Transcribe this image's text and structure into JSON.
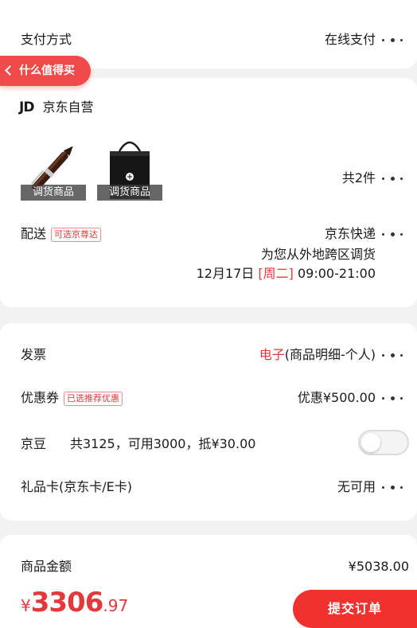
{
  "payment": {
    "label": "支付方式",
    "value": "在线支付"
  },
  "back_pill": {
    "label": "什么值得买"
  },
  "store": {
    "logo": "JD",
    "name": "京东自营",
    "products": [
      {
        "caption": "调货商品",
        "image": "pen-image"
      },
      {
        "caption": "调货商品",
        "image": "gift-bag-image"
      }
    ],
    "count": "共2件",
    "delivery_label": "配送",
    "delivery_tag": "可选京尊达",
    "delivery_method": "京东快递",
    "delivery_note": "为您从外地跨区调货",
    "delivery_date": "12月17日",
    "delivery_weekday": "[周二]",
    "delivery_time": "09:00-21:00"
  },
  "options": {
    "invoice_label": "发票",
    "invoice_type": "电子",
    "invoice_detail": "(商品明细-个人)",
    "coupon_label": "优惠券",
    "coupon_tag": "已选推荐优惠",
    "coupon_value": "优惠¥500.00",
    "jingdou_label": "京豆",
    "jingdou_detail": "共3125，可用3000，抵¥30.00",
    "jingdou_enabled": false,
    "giftcard_label": "礼品卡(京东卡/E卡)",
    "giftcard_value": "无可用"
  },
  "amount": {
    "label": "商品金额",
    "value": "¥5038.00"
  },
  "bottom": {
    "currency": "¥",
    "total_int": "3306",
    "total_dec": ".97",
    "submit_label": "提交订单"
  },
  "colors": {
    "accent": "#e4393c",
    "button": "#f0312e",
    "pill": "#f04a4a"
  }
}
